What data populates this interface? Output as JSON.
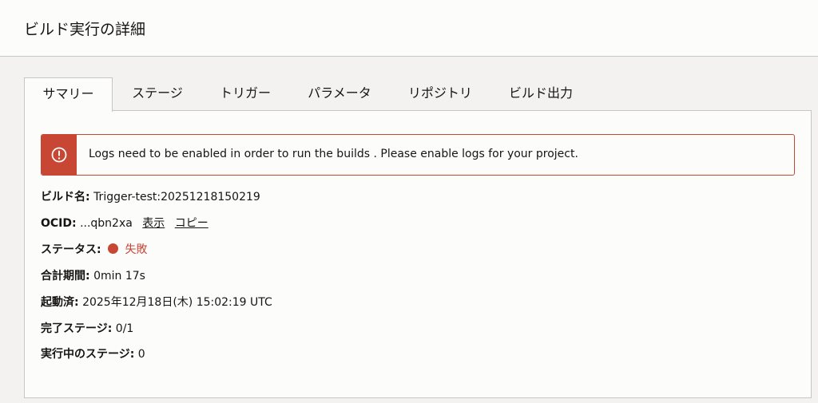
{
  "page": {
    "title": "ビルド実行の詳細"
  },
  "tabs": [
    {
      "label": "サマリー",
      "active": true
    },
    {
      "label": "ステージ"
    },
    {
      "label": "トリガー"
    },
    {
      "label": "パラメータ"
    },
    {
      "label": "リポジトリ"
    },
    {
      "label": "ビルド出力"
    }
  ],
  "alert": {
    "icon": "error-icon",
    "message": "Logs need to be enabled in order to run the builds . Please enable logs for your project.",
    "color": "#c74634"
  },
  "details": {
    "build_name": {
      "label": "ビルド名:",
      "value": "Trigger-test:20251218150219"
    },
    "ocid": {
      "label": "OCID:",
      "value": "...qbn2xa",
      "show_link": "表示",
      "copy_link": "コピー"
    },
    "status": {
      "label": "ステータス:",
      "value": "失敗",
      "color": "#c74634"
    },
    "total_duration": {
      "label": "合計期間:",
      "value": "0min 17s"
    },
    "started": {
      "label": "起動済:",
      "value": "2025年12月18日(木) 15:02:19 UTC"
    },
    "completed_stages": {
      "label": "完了ステージ:",
      "value": "0/1"
    },
    "running_stages": {
      "label": "実行中のステージ:",
      "value": "0"
    }
  }
}
